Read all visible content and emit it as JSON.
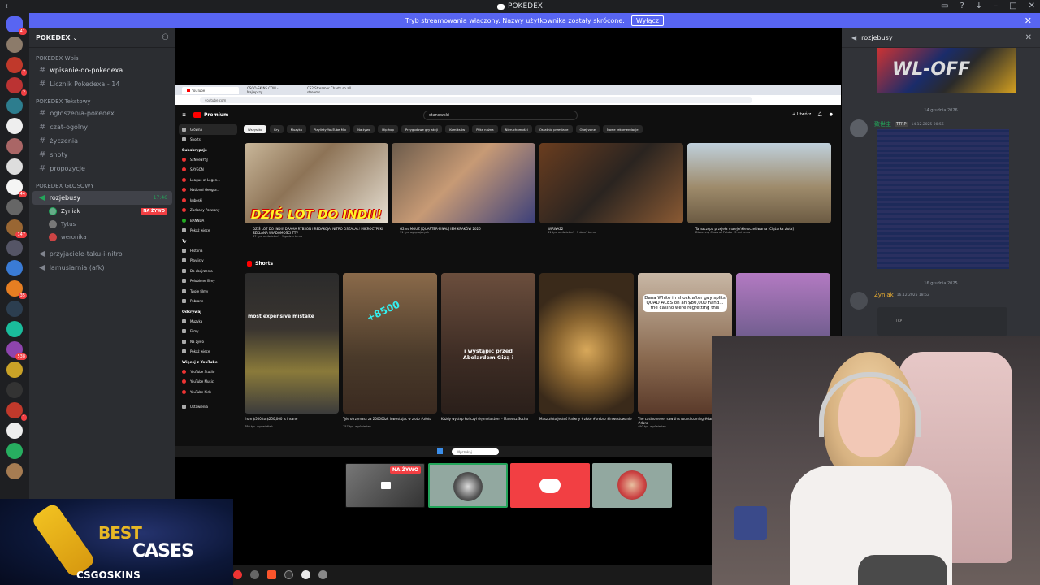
{
  "window": {
    "title": "POKEDEX"
  },
  "banner": {
    "text": "Tryb streamowania włączony. Nazwy użytkownika zostały skrócone.",
    "button": "Wyłącz"
  },
  "server": {
    "name": "POKEDEX"
  },
  "channels": {
    "cat1": "POKEDEX Wpis",
    "c1": "wpisanie-do-pokedexa",
    "c2": "Licznik Pokedexa - 14",
    "cat2": "POKEDEX Tekstowy",
    "c3": "ogłoszenia-pokedex",
    "c4": "czat-ogólny",
    "c5": "życzenia",
    "c6": "shoty",
    "c7": "propozycje",
    "cat3": "POKEDEX GŁOSOWY",
    "voice": "rozjebusy",
    "voice_time": "17:46",
    "u1": "Żyniak",
    "u1_badge": "NA ŻYWO",
    "u2": "Tytus",
    "u3": "weronika",
    "c8": "przyjaciele-taku-i-nitro",
    "c9": "lamusiarnia (afk)"
  },
  "rail_badges": [
    "41",
    "7",
    "2",
    "44",
    "147",
    "35",
    "538",
    "1"
  ],
  "browser": {
    "tab1": "YouTube",
    "tab2": "CSGO-SKINS.COM - Najlepszy",
    "tab3": "CS2 Streamer Charts so all streams",
    "url": "youtube.com",
    "logo": "Premium",
    "search": "stanowski",
    "create": "+ Utwórz"
  },
  "sidebar": {
    "main": [
      "Główna",
      "Shorts"
    ],
    "subs_header": "Subskrypcje",
    "subs": [
      "SzNeeNYSJ",
      "SAYGON",
      "League of Legen...",
      "National Geogra...",
      "kuboski",
      "Zadbany Pozwany",
      "BANNDA",
      "Pokaż więcej"
    ],
    "you_header": "Ty",
    "you": [
      "Historia",
      "Playlisty",
      "Do obejrzenia",
      "Polubione filmy",
      "Twoje filmy",
      "Pobrane"
    ],
    "explore_header": "Odkrywaj",
    "explore": [
      "Muzyka",
      "Filmy",
      "Na żywo",
      "Pokaż więcej"
    ],
    "more_header": "Więcej z YouTube",
    "more": [
      "YouTube Studio",
      "YouTube Music",
      "YouTube Kids"
    ],
    "settings": "Ustawienia"
  },
  "chips": [
    "Wszystko",
    "Gry",
    "Muzyka",
    "Playlisty YouTube Mix",
    "Na żywo",
    "Hip hop",
    "Przygodowe gry akcji",
    "Komiksów",
    "Piłka nożna",
    "Nieruchomości",
    "Ostatnio przesłane",
    "Obejrzane",
    "Nowe rekomendacje"
  ],
  "videos": [
    {
      "title": "DZIŚ LOT DO INDII! DRAMA RYBSON I REDAKCJAI NITRO OSZALAŁ! MIKROCYPEKI SZKLANA WIADOMOŚCI TTV",
      "meta": "67 tys. wyświetleń · 9 godzin temu",
      "overlay": "DZIŚ LOT DO INDII!"
    },
    {
      "title": "G2 vs MOUZ [QUARTER-FINAL] IEM KRAKÓW 2026",
      "meta": "11 tys. oglądających",
      "overlay": ""
    },
    {
      "title": "WIRWA22",
      "meta": "61 tys. wyświetleń · 1 dzień temu",
      "overlay": ""
    },
    {
      "title": "Ta naczepa przejeła malejeńkie oczekiwania [Ciężarka złota]",
      "meta": "Discovery Channel Polska · 3 dni temu",
      "overlay": ""
    }
  ],
  "shorts_header": "Shorts",
  "shorts": [
    {
      "title": "from $500 to $250,000 is insane",
      "meta": "780 tys. wyświetleń",
      "overlay": "most expensive mistake"
    },
    {
      "title": "Tyle otrzymasz za 200000zł, inwestując w złoto #złoto",
      "meta": "157 tys. wyświetleń",
      "overlay": "+8500"
    },
    {
      "title": "Każdy występ kończył się melanżem - Mateusz Socha",
      "meta": "",
      "overlay": "i wystąpić przed Abelardem Gizą i"
    },
    {
      "title": "Masz złoto jesteś Naiwny #złoto #srebro #inwestowanie",
      "meta": "",
      "overlay": ""
    },
    {
      "title": "The casino never saw this round coming #danawhite #dana",
      "meta": "490 tys. wyświetleń",
      "overlay": "Dana White in shock after guy splits QUAD ACES on an $80,000 hand... the casino were regretting this"
    },
    {
      "title": "",
      "meta": "",
      "overlay": ""
    }
  ],
  "taskbar": {
    "search": "Wyszukaj"
  },
  "strip": {
    "live_badge": "NA ŻYWO"
  },
  "chat": {
    "channel": "rozjebusy",
    "banner_text": "WL-OFF",
    "date1": "14 grudnia 2026",
    "author1": "致世主",
    "author1_tag": "TTRP",
    "time1": "14.12.2025 00:56",
    "date2": "16 grudnia 2025",
    "author2": "Żyniak",
    "time2": "16.12.2025 18:52",
    "card_tag": "TTRP"
  },
  "overlay": {
    "best": "BEST",
    "cases": "CASES",
    "brand": "CSGOSKINS"
  },
  "colors": {
    "blurple": "#5865f2",
    "live_red": "#f23f43",
    "online_green": "#23a55a",
    "yt_red": "#ff0000"
  }
}
